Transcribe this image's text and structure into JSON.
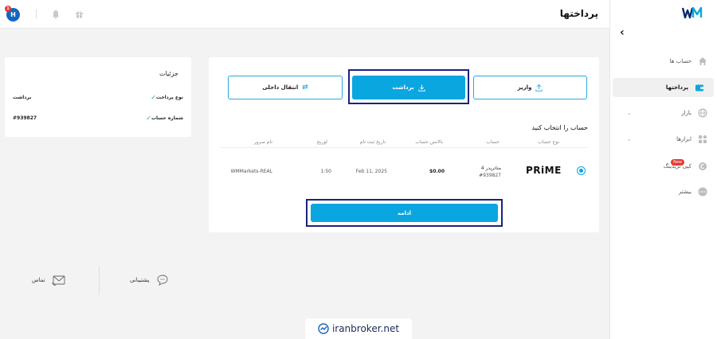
{
  "topbar": {
    "page_title": "پرداختها",
    "avatar_letter": "H",
    "notification_count": "1"
  },
  "sidebar": {
    "logo_text": "WM",
    "collapse_glyph": "‹",
    "items": [
      {
        "label": "حساب ها",
        "icon": "home-icon"
      },
      {
        "label": "پرداختها",
        "icon": "wallet-icon",
        "active": true
      },
      {
        "label": "بازار",
        "icon": "globe-icon",
        "expandable": true
      },
      {
        "label": "ابزارها",
        "icon": "tools-icon",
        "expandable": true
      },
      {
        "label": "کپی تریدینگ",
        "icon": "copy-trading-icon",
        "badge": "New"
      },
      {
        "label": "بیشتر",
        "icon": "more-icon"
      }
    ]
  },
  "details": {
    "title": "جزئیات",
    "rows": [
      {
        "key": "نوع پرداخت",
        "value": "برداشت"
      },
      {
        "key": "شماره حساب",
        "value": "#939827"
      }
    ]
  },
  "payment": {
    "buttons": {
      "deposit": "واریز",
      "withdraw": "برداشت",
      "transfer": "انتقال داخلی"
    },
    "select_title": "حساب را انتخاب کنید",
    "columns": [
      "نوع حساب",
      "حساب",
      "بالانس حساب",
      "تاریخ ثبت نام",
      "لوریج",
      "نام سرور"
    ],
    "row": {
      "account_type": "PRiME",
      "account_name": "متاتریدر 4",
      "account_number": "#939827",
      "balance": "$0.00",
      "registration_date": "Feb 11, 2025",
      "leverage": "1:50",
      "server": "WMMarkets-REAL"
    },
    "continue_label": "ادامه"
  },
  "footer": {
    "support_label": "پشتیبانی",
    "contact_label": "تماس"
  },
  "watermark": {
    "text": "iranbroker.net"
  },
  "colors": {
    "accent": "#0aa6e0",
    "highlight_border": "#1a237e",
    "check": "#26a69a",
    "badge_red": "#e53935"
  }
}
